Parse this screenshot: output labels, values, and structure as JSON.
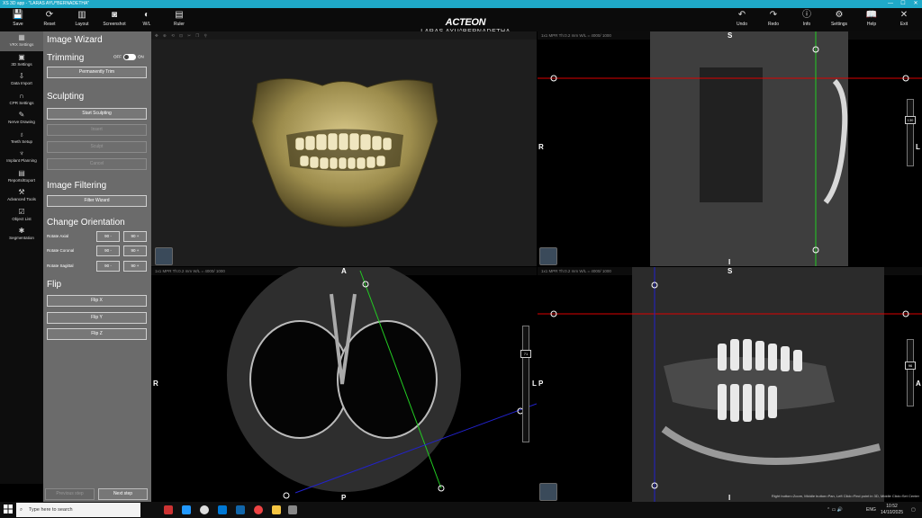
{
  "window": {
    "title": "XS 3D app - \"LARAS AYU^BERNADETHA\""
  },
  "toolbar": {
    "left": [
      {
        "label": "Save",
        "icon": "save-icon"
      },
      {
        "label": "Reset",
        "icon": "reset-icon"
      },
      {
        "label": "Layout",
        "icon": "layout-icon"
      },
      {
        "label": "Screenshot",
        "icon": "camera-icon"
      },
      {
        "label": "W/L",
        "icon": "contrast-icon"
      },
      {
        "label": "Ruler",
        "icon": "ruler-icon"
      }
    ],
    "right": [
      {
        "label": "Undo",
        "icon": "undo-icon"
      },
      {
        "label": "Redo",
        "icon": "redo-icon"
      },
      {
        "label": "Info",
        "icon": "info-icon"
      },
      {
        "label": "Settings",
        "icon": "gear-icon"
      },
      {
        "label": "Help",
        "icon": "help-book-icon"
      },
      {
        "label": "Exit",
        "icon": "exit-icon"
      }
    ],
    "brand": "ACTEON",
    "patient": "LARAS AYU^BERNADETHA"
  },
  "rail": [
    {
      "label": "VRX Settings",
      "active": true
    },
    {
      "label": "3D Settings"
    },
    {
      "label": "Data Import"
    },
    {
      "label": "CPR Settings"
    },
    {
      "label": "Nerve Drawing"
    },
    {
      "label": "Teeth Setup"
    },
    {
      "label": "Implant Planning"
    },
    {
      "label": "Reports/Export"
    },
    {
      "label": "Advanced Tools"
    },
    {
      "label": "Object List"
    },
    {
      "label": "Segmentation"
    }
  ],
  "wizard": {
    "title": "Image Wizard",
    "trimming": {
      "title": "Trimming",
      "off": "OFF",
      "on": "ON",
      "button": "Permanently Trim"
    },
    "sculpting": {
      "title": "Sculpting",
      "start": "Start Sculpting",
      "b2": "Insert",
      "b3": "Sculpt",
      "b4": "Cancel"
    },
    "filtering": {
      "title": "Image Filtering",
      "button": "Filter Wizard"
    },
    "orientation": {
      "title": "Change Orientation",
      "rows": [
        {
          "label": "Rotate Axial",
          "minus": "90 -",
          "plus": "90 +"
        },
        {
          "label": "Rotate Coronal",
          "minus": "90 -",
          "plus": "90 +"
        },
        {
          "label": "Rotate Sagittal",
          "minus": "90 -",
          "plus": "90 +"
        }
      ]
    },
    "flip": {
      "title": "Flip",
      "x": "Flip X",
      "y": "Flip Y",
      "z": "Flip Z"
    },
    "prev": "Previous step",
    "next": "Next step"
  },
  "views": {
    "tl": {
      "bar": ""
    },
    "tr": {
      "bar": "1x1  MPR  Th:0.2 mm  W/L = 4000/ 1000",
      "S": "S",
      "I": "I",
      "R": "R",
      "L": "L",
      "slider": "130"
    },
    "bl": {
      "bar": "1x1  MPR  Th:0.2 mm  W/L = 4000/ 1000",
      "A": "A",
      "P": "P",
      "R": "R",
      "L": "L",
      "slider": "71"
    },
    "br": {
      "bar": "1x1  MPR  Th:0.2 mm  W/L = 4000/ 1000",
      "S": "S",
      "I": "I",
      "P": "P",
      "A": "A",
      "slider": "96",
      "hint": "Right button=Zoom, Middle button=Pan, Left Click=Find point in 3D, Middle Click=Set Center"
    }
  },
  "taskbar": {
    "search": "Type here to search",
    "lang": "ENG",
    "time": "10:52",
    "date": "14/10/2025"
  }
}
